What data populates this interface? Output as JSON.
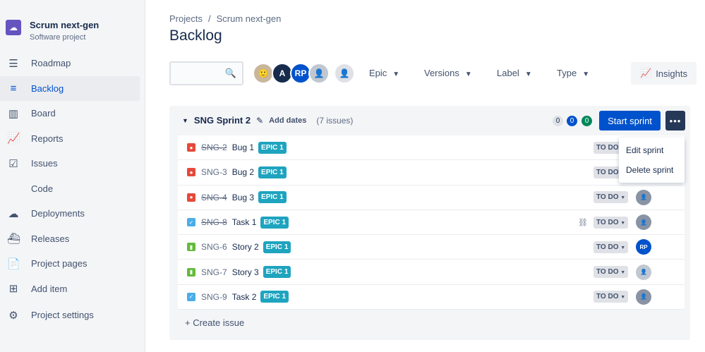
{
  "project": {
    "name": "Scrum next-gen",
    "type": "Software project"
  },
  "nav": [
    {
      "label": "Roadmap",
      "icon": "roadmap-icon"
    },
    {
      "label": "Backlog",
      "icon": "backlog-icon",
      "active": true
    },
    {
      "label": "Board",
      "icon": "board-icon"
    },
    {
      "label": "Reports",
      "icon": "reports-icon"
    },
    {
      "label": "Issues",
      "icon": "issues-icon"
    },
    {
      "label": "Code",
      "icon": "code-icon"
    },
    {
      "label": "Deployments",
      "icon": "deployments-icon"
    },
    {
      "label": "Releases",
      "icon": "releases-icon"
    },
    {
      "label": "Project pages",
      "icon": "pages-icon"
    },
    {
      "label": "Add item",
      "icon": "add-item-icon"
    },
    {
      "label": "Project settings",
      "icon": "gear-icon"
    }
  ],
  "breadcrumb": [
    "Projects",
    "/",
    "Scrum next-gen"
  ],
  "title": "Backlog",
  "search": {
    "placeholder": ""
  },
  "avatars": [
    "",
    "A",
    "RP",
    ""
  ],
  "filters": [
    "Epic",
    "Versions",
    "Label",
    "Type"
  ],
  "insights": "Insights",
  "sprint": {
    "name": "SNG Sprint 2",
    "add_dates": "Add dates",
    "count": "(7 issues)",
    "badges": [
      "0",
      "0",
      "0"
    ],
    "start": "Start sprint",
    "more": "•••",
    "issues": [
      {
        "type": "bug",
        "key": "SNG-2",
        "summary": "Bug 1",
        "epic": "EPIC 1",
        "status": "TO DO",
        "assignee": "",
        "done": true
      },
      {
        "type": "bug",
        "key": "SNG-3",
        "summary": "Bug 2",
        "epic": "EPIC 1",
        "status": "TO DO",
        "assignee": "",
        "done": false
      },
      {
        "type": "bug",
        "key": "SNG-4",
        "summary": "Bug 3",
        "epic": "EPIC 1",
        "status": "TO DO",
        "assignee": "unassigned",
        "done": true
      },
      {
        "type": "task",
        "key": "SNG-8",
        "summary": "Task 1",
        "epic": "EPIC 1",
        "status": "TO DO",
        "assignee": "unassigned",
        "done": true,
        "child": true
      },
      {
        "type": "story",
        "key": "SNG-6",
        "summary": "Story 2",
        "epic": "EPIC 1",
        "status": "TO DO",
        "assignee": "RP",
        "done": false
      },
      {
        "type": "story",
        "key": "SNG-7",
        "summary": "Story 3",
        "epic": "EPIC 1",
        "status": "TO DO",
        "assignee": "unassigned-light",
        "done": false
      },
      {
        "type": "task",
        "key": "SNG-9",
        "summary": "Task 2",
        "epic": "EPIC 1",
        "status": "TO DO",
        "assignee": "unassigned",
        "done": false
      }
    ],
    "create": "+ Create issue"
  },
  "menu": [
    "Edit sprint",
    "Delete sprint"
  ],
  "colors": {
    "bug": "#e5493a",
    "task": "#4bade8",
    "story": "#63ba3c",
    "epic": "#1ea4bf",
    "primary": "#0052cc"
  }
}
